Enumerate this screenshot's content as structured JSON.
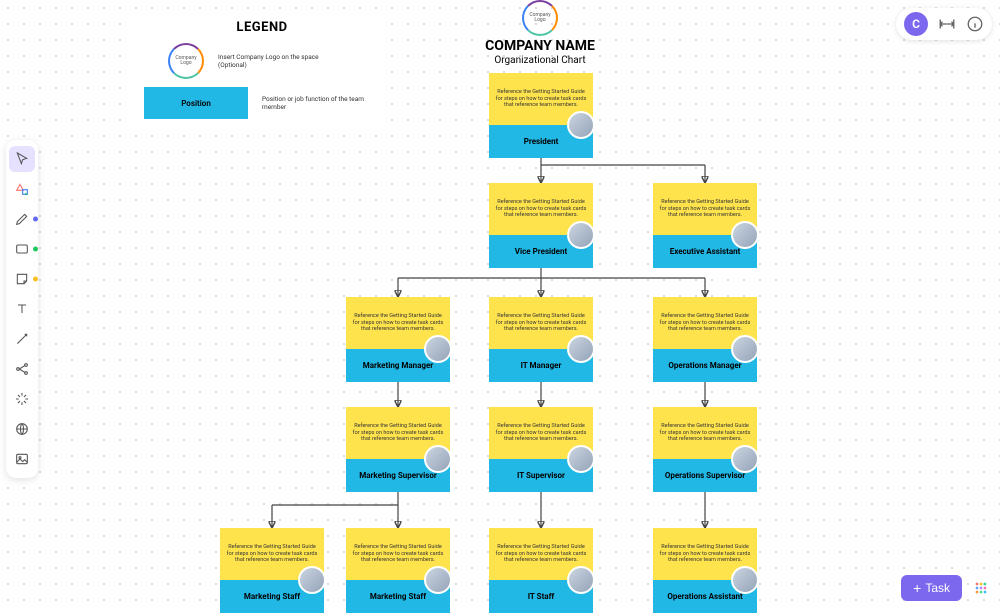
{
  "header": {
    "logo_text": "Company Logo",
    "company_name": "COMPANY NAME",
    "subtitle": "Organizational Chart"
  },
  "legend": {
    "title": "LEGEND",
    "logo_text": "Company Logo",
    "logo_desc": "Insert Company Logo on the space (Optional)",
    "position_label": "Position",
    "position_desc": "Position or job function of the team member"
  },
  "desc": "Reference the Getting Started Guide for steps on how to create task cards that reference team members.",
  "cards": {
    "president": "President",
    "vp": "Vice President",
    "ea": "Executive Assistant",
    "mkt_mgr": "Marketing Manager",
    "it_mgr": "IT Manager",
    "ops_mgr": "Operations Manager",
    "mkt_sup": "Marketing Supervisor",
    "it_sup": "IT Supervisor",
    "ops_sup": "Operations Supervisor",
    "mkt_staff1": "Marketing Staff",
    "mkt_staff2": "Marketing Staff",
    "it_staff": "IT Staff",
    "ops_asst": "Operations Assistant"
  },
  "topright": {
    "avatar_letter": "C"
  },
  "task_button": "Task"
}
